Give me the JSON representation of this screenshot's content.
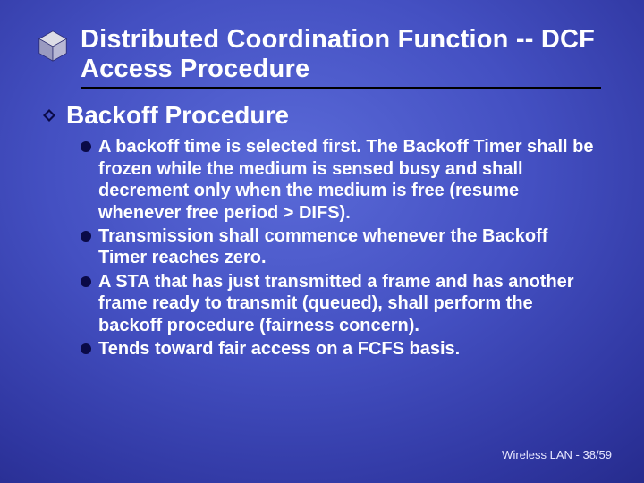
{
  "title": "Distributed Coordination Function -- DCF Access Procedure",
  "subheading": "Backoff Procedure",
  "bullets": [
    "A backoff time is selected first. The Backoff Timer shall be frozen while the medium is sensed busy and shall decrement only when the medium is free (resume whenever free period > DIFS).",
    "Transmission shall commence whenever the Backoff Timer reaches zero.",
    "A STA that has  just transmitted a frame and has another frame ready to transmit (queued), shall perform the backoff procedure (fairness concern).",
    "Tends toward fair access on a FCFS basis."
  ],
  "footer": "Wireless LAN - 38/59"
}
